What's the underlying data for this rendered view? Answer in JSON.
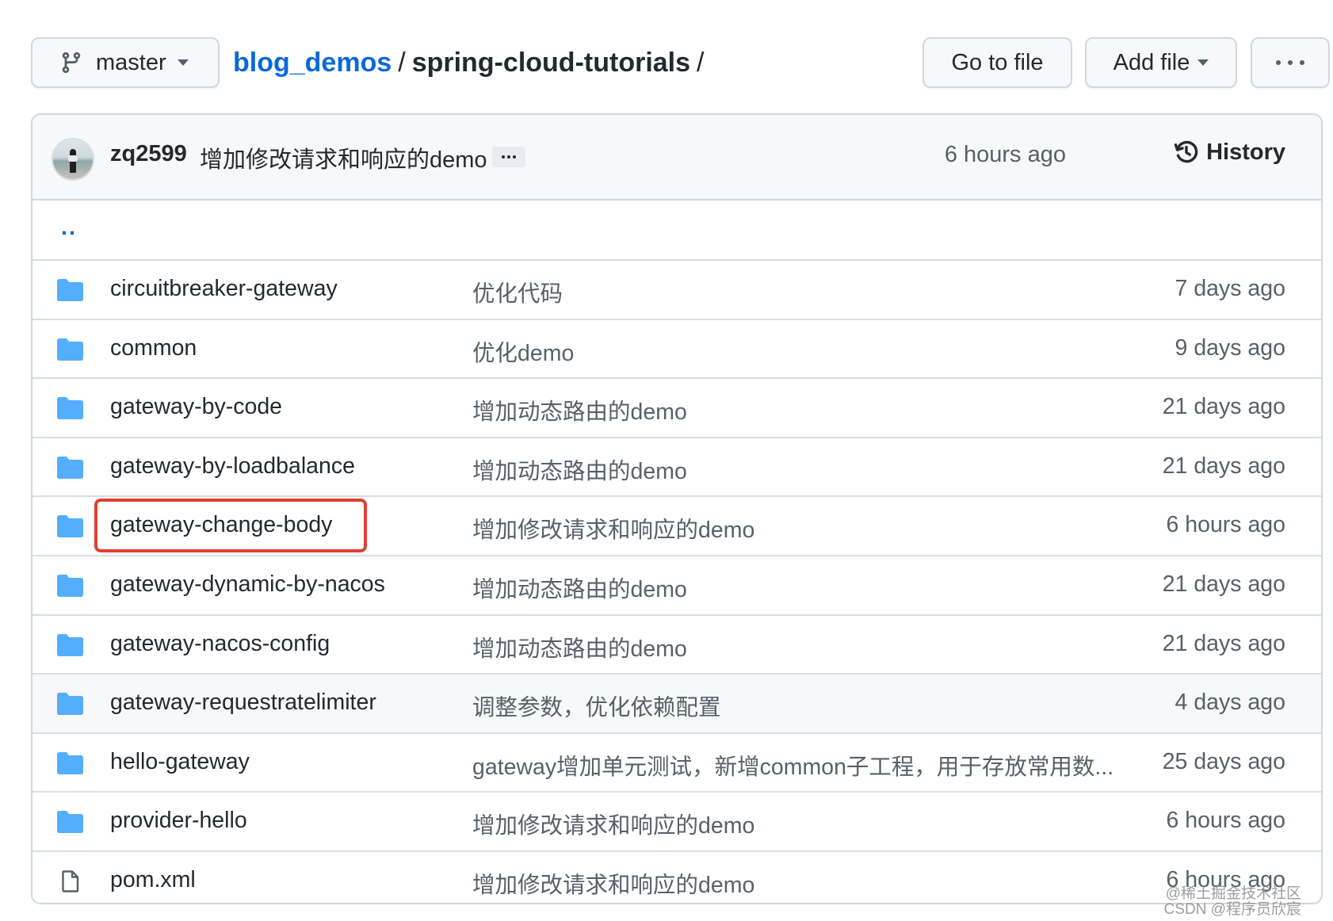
{
  "toolbar": {
    "branch": "master",
    "go_to_file": "Go to file",
    "add_file": "Add file"
  },
  "breadcrumb": {
    "repo": "blog_demos",
    "separator": "/",
    "directory": "spring-cloud-tutorials",
    "trailing": "/"
  },
  "commit": {
    "author": "zq2599",
    "message": "增加修改请求和响应的demo",
    "time": "6 hours ago",
    "history_label": "History"
  },
  "parent_link": "..",
  "files": [
    {
      "type": "folder",
      "name": "circuitbreaker-gateway",
      "message": "优化代码",
      "age": "7 days ago"
    },
    {
      "type": "folder",
      "name": "common",
      "message": "优化demo",
      "age": "9 days ago"
    },
    {
      "type": "folder",
      "name": "gateway-by-code",
      "message": "增加动态路由的demo",
      "age": "21 days ago"
    },
    {
      "type": "folder",
      "name": "gateway-by-loadbalance",
      "message": "增加动态路由的demo",
      "age": "21 days ago"
    },
    {
      "type": "folder",
      "name": "gateway-change-body",
      "message": "增加修改请求和响应的demo",
      "age": "6 hours ago",
      "highlighted": true
    },
    {
      "type": "folder",
      "name": "gateway-dynamic-by-nacos",
      "message": "增加动态路由的demo",
      "age": "21 days ago"
    },
    {
      "type": "folder",
      "name": "gateway-nacos-config",
      "message": "增加动态路由的demo",
      "age": "21 days ago"
    },
    {
      "type": "folder",
      "name": "gateway-requestratelimiter",
      "message": "调整参数，优化依赖配置",
      "age": "4 days ago",
      "hovered": true
    },
    {
      "type": "folder",
      "name": "hello-gateway",
      "message": "gateway增加单元测试，新增common子工程，用于存放常用数...",
      "age": "25 days ago"
    },
    {
      "type": "folder",
      "name": "provider-hello",
      "message": "增加修改请求和响应的demo",
      "age": "6 hours ago"
    },
    {
      "type": "file",
      "name": "pom.xml",
      "message": "增加修改请求和响应的demo",
      "age": "6 hours ago"
    }
  ],
  "watermark": {
    "line1": "@稀土掘金技术社区",
    "line2": "CSDN @程序员欣宸"
  },
  "colors": {
    "link": "#0969da",
    "folder": "#54aeff",
    "highlight_border": "#e43d30",
    "muted_text": "#57606a"
  }
}
